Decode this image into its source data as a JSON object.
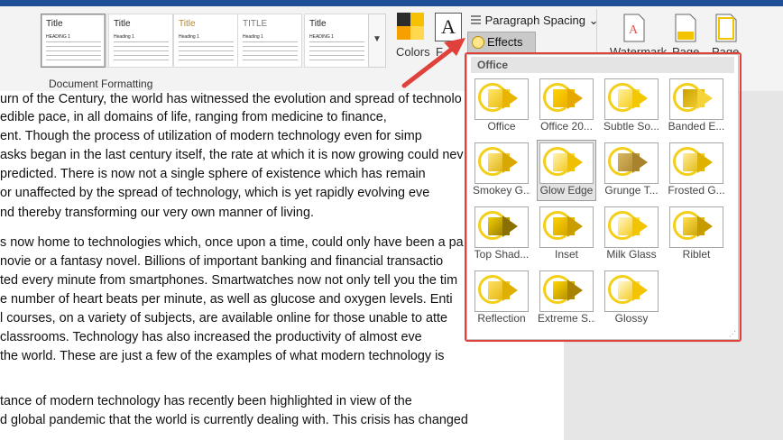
{
  "ribbon": {
    "style_thumbs": [
      {
        "title": "Title",
        "heading": "HEADING 1",
        "title_color": "#222222"
      },
      {
        "title": "Title",
        "heading": "Heading 1",
        "title_color": "#222222"
      },
      {
        "title": "Title",
        "heading": "Heading 1",
        "title_color": "#222222"
      },
      {
        "title": "Title",
        "heading": "Heading 1",
        "title_color": "#b5882c"
      },
      {
        "title": "TITLE",
        "heading": "Heading 1",
        "title_color": "#7a7a7a"
      },
      {
        "title": "Title",
        "heading": "HEADING 1",
        "title_color": "#222222"
      }
    ],
    "group_label": "Document Formatting",
    "colors_label": "Colors",
    "fonts_label": "F",
    "fonts_glyph": "A",
    "paragraph_spacing_label": "Paragraph Spacing",
    "effects_label": "Effects",
    "watermark_label": "Watermark",
    "page_color_label": "Page",
    "page_borders_label": "Page",
    "dropdown_chevron": "⌄",
    "colors_swatches": [
      "#2b2b2b",
      "#f5c100",
      "#f5a000",
      "#ffd84d"
    ]
  },
  "document": {
    "lines": [
      "urn of the Century, the world has witnessed the evolution and spread of technolo",
      "edible pace, in all domains of life, ranging from medicine to finance,",
      "ent. Though the process of utilization of modern technology even for simp",
      "asks began in the last century itself, the rate at which it is now growing could nev",
      " predicted. There is now not a single sphere of existence which has remain",
      " or unaffected by the spread of technology, which is yet rapidly evolving eve",
      "nd thereby transforming our very own manner of living.",
      "s now home to technologies which, once upon a time, could only have been a pa",
      "novie or a fantasy novel. Billions of important banking and financial transactio",
      "ted every minute from smartphones. Smartwatches now not only tell you the tim",
      "e number of heart beats per minute, as well as glucose and oxygen levels. Enti",
      "l courses, on a variety of subjects, are available online for those unable to atte",
      " classrooms. Technology has also increased the productivity of almost eve",
      " the world. These are just a few of the examples of what modern technology is",
      "tance of modern technology has recently been highlighted in view of the",
      "d global pandemic that the world is currently dealing with. This crisis has changed"
    ]
  },
  "effects_menu": {
    "header": "Office",
    "items": [
      {
        "label": "Office",
        "variant": "office",
        "selected": false
      },
      {
        "label": "Office 20...",
        "variant": "office2013",
        "selected": false
      },
      {
        "label": "Subtle So...",
        "variant": "subtle",
        "selected": false
      },
      {
        "label": "Banded E...",
        "variant": "banded",
        "selected": false
      },
      {
        "label": "Smokey G...",
        "variant": "smokey",
        "selected": false
      },
      {
        "label": "Glow Edge",
        "variant": "glow",
        "selected": true
      },
      {
        "label": "Grunge T...",
        "variant": "grunge",
        "selected": false
      },
      {
        "label": "Frosted G...",
        "variant": "frosted",
        "selected": false
      },
      {
        "label": "Top Shad...",
        "variant": "topshadow",
        "selected": false
      },
      {
        "label": "Inset",
        "variant": "inset",
        "selected": false
      },
      {
        "label": "Milk Glass",
        "variant": "milk",
        "selected": false
      },
      {
        "label": "Riblet",
        "variant": "riblet",
        "selected": false
      },
      {
        "label": "Reflection",
        "variant": "reflection",
        "selected": false
      },
      {
        "label": "Extreme S...",
        "variant": "extreme",
        "selected": false
      },
      {
        "label": "Glossy",
        "variant": "glossy",
        "selected": false
      }
    ]
  },
  "colors": {
    "accent_red": "#e0413a",
    "effect_yellow": "#f2c400",
    "ribbon_blue": "#1f4f96"
  }
}
